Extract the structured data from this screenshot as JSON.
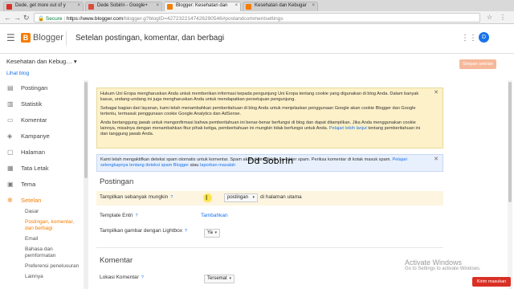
{
  "browser": {
    "tabs": [
      {
        "label": "Dede, get more out of y",
        "color": "#d93025"
      },
      {
        "label": "Dede Sobirin - Google+",
        "color": "#dd4b39"
      },
      {
        "label": "Blogger: Kesehatan dan",
        "color": "#f57d00"
      },
      {
        "label": "Kesehatan dan Kebugar",
        "color": "#f57d00"
      }
    ],
    "url_secure": "Secure",
    "url_host": "https://www.blogger.com",
    "url_path": "/blogger.g?blogID=4272322147426290546#postandcommentsettings"
  },
  "header": {
    "menu_icon": "hamburger-icon",
    "brand": "Blogger",
    "page_title": "Setelan postingan, komentar, dan berbagi",
    "avatar_letter": "D",
    "brand_color": "#f57d00"
  },
  "blog": {
    "name": "Kesehatan dan Kebug…",
    "view_link": "Lihat blog",
    "save_button": "Simpan setelan"
  },
  "sidebar": {
    "items": [
      {
        "label": "Postingan",
        "icon": "posts-icon"
      },
      {
        "label": "Statistik",
        "icon": "stats-icon"
      },
      {
        "label": "Komentar",
        "icon": "comments-icon"
      },
      {
        "label": "Kampanye",
        "icon": "campaigns-icon"
      },
      {
        "label": "Halaman",
        "icon": "pages-icon"
      },
      {
        "label": "Tata Letak",
        "icon": "layout-icon"
      },
      {
        "label": "Tema",
        "icon": "theme-icon"
      },
      {
        "label": "Setelan",
        "icon": "settings-icon"
      }
    ],
    "subitems": [
      {
        "label": "Dasar"
      },
      {
        "label": "Postingan, komentar, dan berbagi"
      },
      {
        "label": "Email"
      },
      {
        "label": "Bahasa dan pemformatan"
      },
      {
        "label": "Preferensi penelusuran"
      },
      {
        "label": "Lainnya"
      }
    ]
  },
  "notice": {
    "p1": "Hukum Uni Eropa mengharuskan Anda untuk memberikan informasi kepada pengunjung Uni Eropa tentang cookie yang digunakan di blog Anda. Dalam banyak kasus, undang-undang ini juga mengharuskan Anda untuk mendapatkan persetujuan pengunjung.",
    "p2": "Sebagai bagian dari layanan, kami telah menambahkan pemberitahuan di blog Anda untuk menjelaskan penggunaan Google akan cookie Blogger dan Google tertentu, termasuk penggunaan cookie Google Analytics dan AdSense.",
    "p3": "Anda bertanggung jawab untuk mengonfirmasi bahwa pemberitahuan ini benar-benar berfungsi di blog dan dapat ditampilkan. Jika Anda menggunakan cookie lainnya, misalnya dengan menambahkan fitur pihak ketiga, pemberitahuan ini mungkin tidak berfungsi untuk Anda.",
    "p3_link": "Pelajari lebih lanjut",
    "p4": "tentang pemberitahuan ini dan tanggung jawab Anda."
  },
  "spam_notice": {
    "text": "Kami telah mengaktifkan deteksi spam otomatis untuk komentar. Spam akan dipindahkan ke folder spam. Periksa komentar di kotak masuk spam.",
    "link1": "Pelajari selengkapnya tentang deteksi spam Blogger",
    "mid": "atau",
    "link2": "laporkan masalah"
  },
  "overlay_text": "Dd Sobirin",
  "postingan": {
    "heading": "Postingan",
    "show_label": "Tampilkan sebanyak mungkin",
    "show_select": "postingan",
    "show_after": "di halaman utama",
    "template_label": "Template Entri",
    "template_link": "Tambahkan",
    "lightbox_label": "Tampilkan gambar dengan Lightbox",
    "lightbox_select": "Ya",
    "help": "?"
  },
  "komentar": {
    "heading": "Komentar",
    "location_label": "Lokasi Komentar",
    "location_select": "Tersemat"
  },
  "watermark": {
    "line1": "Activate Windows",
    "line2": "Go to Settings to activate Windows."
  },
  "feedback_button": "Kirim masukan"
}
